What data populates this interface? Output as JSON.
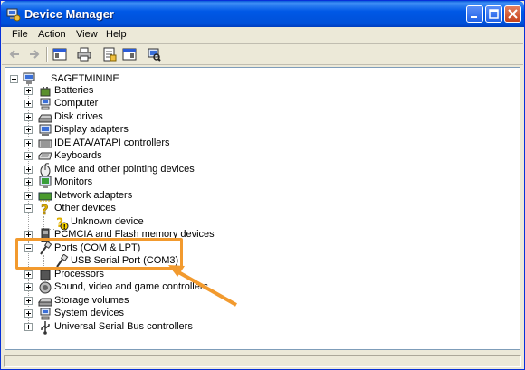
{
  "window": {
    "title": "Device Manager"
  },
  "menu": [
    "File",
    "Action",
    "View",
    "Help"
  ],
  "tree": {
    "root": "SAGETMININE",
    "items": [
      {
        "label": "Batteries",
        "icon": "battery-icon"
      },
      {
        "label": "Computer",
        "icon": "computer-icon"
      },
      {
        "label": "Disk drives",
        "icon": "disk-drive-icon"
      },
      {
        "label": "Display adapters",
        "icon": "display-adapter-icon"
      },
      {
        "label": "IDE ATA/ATAPI controllers",
        "icon": "ide-controller-icon"
      },
      {
        "label": "Keyboards",
        "icon": "keyboard-icon"
      },
      {
        "label": "Mice and other pointing devices",
        "icon": "mouse-icon"
      },
      {
        "label": "Monitors",
        "icon": "monitor-icon"
      },
      {
        "label": "Network adapters",
        "icon": "network-adapter-icon"
      },
      {
        "label": "Other devices",
        "icon": "unknown-device-icon",
        "children": [
          "Unknown device"
        ]
      },
      {
        "label": "PCMCIA and Flash memory devices",
        "icon": "pcmcia-icon"
      },
      {
        "label": "Ports (COM & LPT)",
        "icon": "port-icon",
        "children": [
          "USB Serial Port (COM3)"
        ]
      },
      {
        "label": "Processors",
        "icon": "processor-icon"
      },
      {
        "label": "Sound, video and game controllers",
        "icon": "sound-icon"
      },
      {
        "label": "Storage volumes",
        "icon": "storage-volume-icon"
      },
      {
        "label": "System devices",
        "icon": "system-device-icon"
      },
      {
        "label": "Universal Serial Bus controllers",
        "icon": "usb-icon"
      }
    ]
  },
  "colors": {
    "titlebar": "#0058e6",
    "highlight": "#f29a2e"
  }
}
